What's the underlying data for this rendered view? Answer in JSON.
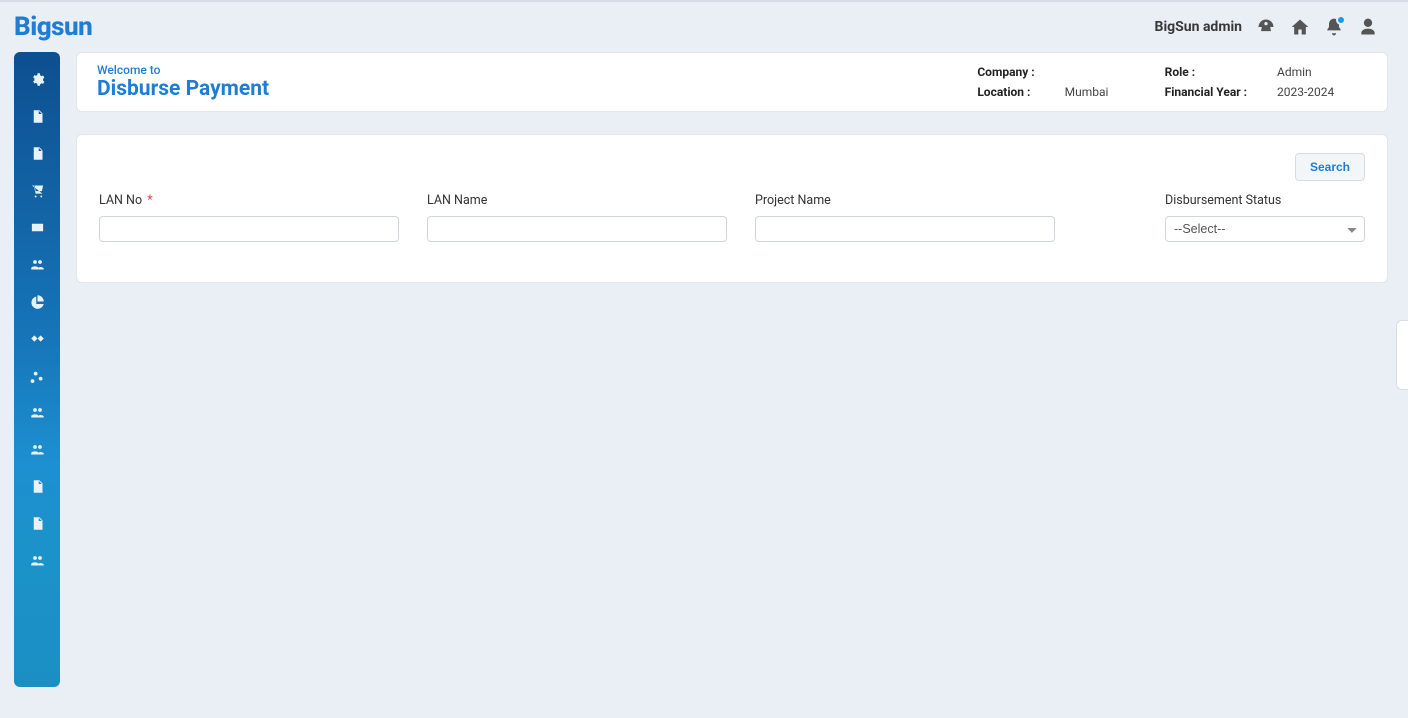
{
  "brand": "Bigsun",
  "user": {
    "name": "BigSun admin"
  },
  "page": {
    "welcome": "Welcome to",
    "title": "Disburse Payment"
  },
  "context": {
    "company_label": "Company :",
    "company_value": "",
    "location_label": "Location :",
    "location_value": "Mumbai",
    "role_label": "Role :",
    "role_value": "Admin",
    "fy_label": "Financial Year :",
    "fy_value": "2023-2024"
  },
  "buttons": {
    "search": "Search"
  },
  "form": {
    "lan_no": {
      "label": "LAN No",
      "required": "*",
      "value": ""
    },
    "lan_name": {
      "label": "LAN Name",
      "value": ""
    },
    "project_name": {
      "label": "Project Name",
      "value": ""
    },
    "status": {
      "label": "Disbursement Status",
      "selected": "--Select--"
    }
  },
  "sidebar": {
    "items": [
      "gear",
      "file",
      "file",
      "cart",
      "card",
      "users",
      "chart-pie",
      "handshake",
      "cogs",
      "users",
      "users",
      "file",
      "file",
      "users"
    ]
  }
}
